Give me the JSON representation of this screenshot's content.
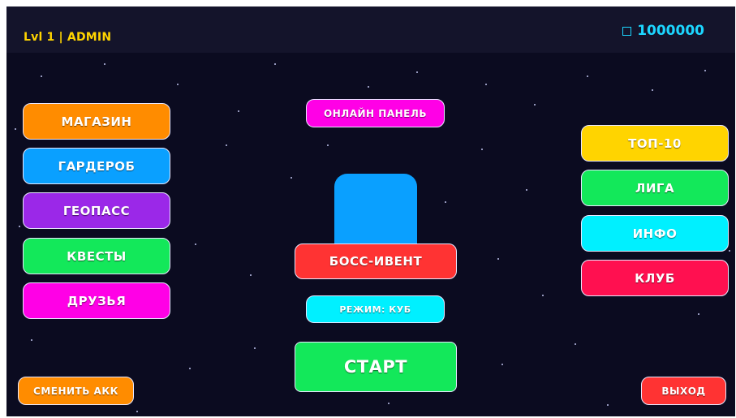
{
  "header": {
    "level_label": "Lvl 1 | ADMIN",
    "currency_icon": "square-icon",
    "currency_value": "1000000"
  },
  "left_menu": [
    {
      "label": "МАГАЗИН",
      "color": "#ff8c00"
    },
    {
      "label": "ГАРДЕРОБ",
      "color": "#0aa0ff"
    },
    {
      "label": "ГЕОПАСС",
      "color": "#9b28e8"
    },
    {
      "label": "КВЕСТЫ",
      "color": "#13e85a"
    },
    {
      "label": "ДРУЗЬЯ",
      "color": "#ff00e6"
    }
  ],
  "right_menu": [
    {
      "label": "ТОП-10",
      "color": "#ffd400"
    },
    {
      "label": "ЛИГА",
      "color": "#13e85a"
    },
    {
      "label": "ИНФО",
      "color": "#00f0ff"
    },
    {
      "label": "КЛУБ",
      "color": "#ff1050"
    }
  ],
  "center": {
    "online_panel_label": "ОНЛАЙН ПАНЕЛЬ",
    "online_panel_color": "#ff00e6",
    "boss_figure_color": "#0aa0ff",
    "boss_event_label": "БОСС-ИВЕНТ",
    "boss_event_color": "#ff3333",
    "mode_label": "РЕЖИМ: КУБ",
    "mode_color": "#00f0ff",
    "start_label": "СТАРТ",
    "start_color": "#13e85a"
  },
  "footer": {
    "switch_account_label": "СМЕНИТЬ АКК",
    "switch_account_color": "#ff8c00",
    "exit_label": "ВЫХОД",
    "exit_color": "#ff3333"
  }
}
